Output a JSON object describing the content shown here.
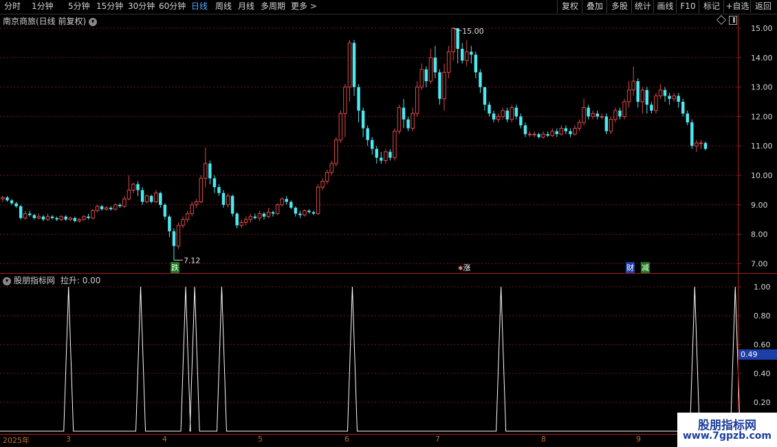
{
  "toolbar": {
    "periods": [
      "分时",
      "1分钟",
      "5分钟",
      "15分钟",
      "30分钟",
      "60分钟",
      "日线",
      "周线",
      "月线",
      "多周期",
      "更多 >"
    ],
    "active": "日线",
    "actions": [
      "复权",
      "叠加",
      "多股",
      "统计",
      "画线",
      "F10",
      "标记",
      "+自选",
      "返回"
    ]
  },
  "main": {
    "title": "南京商旅(日线 前复权)",
    "y_ticks": [
      "15.00",
      "14.00",
      "13.00",
      "12.00",
      "11.00",
      "10.00",
      "9.00",
      "8.00",
      "7.00"
    ],
    "high_label": "15.00",
    "low_label": "7.12",
    "markers": [
      "跌",
      "涨",
      "财",
      "减"
    ]
  },
  "indicator": {
    "name": "股朋指标网",
    "value_text": "拉升: 0.00",
    "y_ticks": [
      "1.00",
      "0.80",
      "0.60",
      "0.40",
      "0.20"
    ],
    "current_value": "0.49"
  },
  "xaxis": {
    "labels": [
      "2025年",
      "3",
      "4",
      "5",
      "6",
      "7",
      "8",
      "9"
    ]
  },
  "watermark": {
    "line1": "股朋指标网",
    "line2": "www.7gpzb.com"
  },
  "colors": {
    "up": "#e54a4a",
    "down": "#4de8f0",
    "grid": "#7a1c1c",
    "axis": "#b02020",
    "active_tab": "#5aa8ff",
    "indicator_line": "#ffffff",
    "value_box": "#1f3fa8"
  },
  "chart_data": [
    {
      "type": "candlestick",
      "title": "南京商旅(日线 前复权)",
      "ylim": [
        6.8,
        15.2
      ],
      "y_ticks": [
        15,
        14,
        13,
        12,
        11,
        10,
        9,
        8,
        7
      ],
      "annotations": [
        {
          "text": "15.00",
          "value": 15.0
        },
        {
          "text": "7.12",
          "value": 7.12
        }
      ],
      "candles": [
        [
          9.2,
          9.25,
          9.1,
          9.3
        ],
        [
          9.25,
          9.15,
          9.1,
          9.3
        ],
        [
          9.15,
          9.05,
          9.0,
          9.2
        ],
        [
          9.05,
          8.95,
          8.9,
          9.1
        ],
        [
          8.95,
          8.55,
          8.5,
          9.0
        ],
        [
          8.55,
          8.7,
          8.5,
          8.8
        ],
        [
          8.7,
          8.65,
          8.6,
          8.8
        ],
        [
          8.65,
          8.55,
          8.5,
          8.7
        ],
        [
          8.55,
          8.6,
          8.5,
          8.7
        ],
        [
          8.6,
          8.5,
          8.45,
          8.65
        ],
        [
          8.5,
          8.6,
          8.45,
          8.7
        ],
        [
          8.6,
          8.55,
          8.5,
          8.65
        ],
        [
          8.55,
          8.5,
          8.45,
          8.6
        ],
        [
          8.5,
          8.6,
          8.45,
          8.65
        ],
        [
          8.6,
          8.5,
          8.45,
          8.65
        ],
        [
          8.5,
          8.55,
          8.45,
          8.6
        ],
        [
          8.55,
          8.45,
          8.4,
          8.6
        ],
        [
          8.45,
          8.5,
          8.4,
          8.55
        ],
        [
          8.5,
          8.6,
          8.45,
          8.65
        ],
        [
          8.6,
          8.55,
          8.5,
          8.7
        ],
        [
          8.55,
          8.8,
          8.5,
          8.85
        ],
        [
          8.8,
          8.95,
          8.75,
          9.0
        ],
        [
          8.95,
          8.85,
          8.8,
          9.0
        ],
        [
          8.85,
          8.9,
          8.8,
          8.95
        ],
        [
          8.9,
          8.85,
          8.8,
          8.95
        ],
        [
          8.85,
          9.0,
          8.8,
          9.05
        ],
        [
          9.0,
          8.95,
          8.9,
          9.05
        ],
        [
          8.95,
          9.2,
          8.9,
          9.3
        ],
        [
          9.2,
          9.5,
          9.15,
          10.0
        ],
        [
          9.5,
          9.7,
          9.4,
          9.75
        ],
        [
          9.7,
          9.5,
          9.3,
          9.8
        ],
        [
          9.5,
          9.1,
          9.0,
          9.6
        ],
        [
          9.1,
          9.3,
          9.05,
          9.35
        ],
        [
          9.3,
          9.1,
          9.05,
          9.35
        ],
        [
          9.1,
          9.4,
          9.05,
          9.5
        ],
        [
          9.4,
          9.0,
          8.9,
          9.45
        ],
        [
          9.0,
          8.6,
          8.5,
          9.05
        ],
        [
          8.6,
          8.1,
          7.9,
          8.65
        ],
        [
          8.1,
          7.6,
          7.12,
          8.2
        ],
        [
          7.6,
          8.3,
          7.5,
          8.4
        ],
        [
          8.3,
          8.5,
          8.2,
          8.6
        ],
        [
          8.5,
          8.7,
          8.4,
          8.8
        ],
        [
          8.7,
          9.0,
          8.6,
          9.1
        ],
        [
          9.0,
          9.1,
          8.9,
          9.2
        ],
        [
          9.1,
          9.9,
          9.05,
          10.0
        ],
        [
          9.9,
          10.4,
          9.6,
          10.95
        ],
        [
          10.4,
          9.9,
          9.7,
          10.5
        ],
        [
          9.9,
          9.6,
          9.4,
          10.0
        ],
        [
          9.6,
          9.4,
          9.3,
          9.7
        ],
        [
          9.4,
          9.0,
          8.9,
          9.5
        ],
        [
          9.0,
          9.3,
          8.9,
          9.4
        ],
        [
          9.3,
          8.7,
          8.6,
          9.35
        ],
        [
          8.7,
          8.3,
          8.2,
          8.75
        ],
        [
          8.3,
          8.4,
          8.2,
          8.5
        ],
        [
          8.4,
          8.5,
          8.3,
          8.6
        ],
        [
          8.5,
          8.6,
          8.4,
          8.7
        ],
        [
          8.6,
          8.55,
          8.5,
          8.7
        ],
        [
          8.55,
          8.7,
          8.45,
          8.8
        ],
        [
          8.7,
          8.6,
          8.5,
          8.75
        ],
        [
          8.6,
          8.75,
          8.55,
          8.9
        ],
        [
          8.75,
          8.7,
          8.6,
          8.8
        ],
        [
          8.7,
          9.0,
          8.65,
          9.05
        ],
        [
          9.0,
          9.2,
          8.95,
          9.25
        ],
        [
          9.2,
          9.1,
          9.0,
          9.3
        ],
        [
          9.1,
          8.9,
          8.85,
          9.15
        ],
        [
          8.9,
          8.7,
          8.6,
          8.95
        ],
        [
          8.7,
          8.65,
          8.55,
          8.8
        ],
        [
          8.65,
          8.8,
          8.6,
          8.85
        ],
        [
          8.8,
          8.75,
          8.7,
          8.85
        ],
        [
          8.75,
          8.7,
          8.65,
          8.8
        ],
        [
          8.7,
          9.6,
          8.65,
          9.7
        ],
        [
          9.6,
          9.8,
          9.5,
          9.9
        ],
        [
          9.8,
          10.1,
          9.7,
          10.2
        ],
        [
          10.1,
          10.4,
          10.0,
          10.5
        ],
        [
          10.4,
          11.2,
          10.3,
          11.3
        ],
        [
          11.2,
          12.1,
          11.1,
          12.2
        ],
        [
          12.1,
          13.0,
          11.3,
          13.1
        ],
        [
          13.0,
          14.5,
          12.5,
          14.6
        ],
        [
          14.5,
          13.0,
          12.7,
          14.6
        ],
        [
          13.0,
          12.2,
          11.8,
          13.1
        ],
        [
          12.2,
          11.6,
          11.3,
          12.3
        ],
        [
          11.6,
          11.2,
          11.0,
          11.7
        ],
        [
          11.2,
          10.9,
          10.7,
          11.3
        ],
        [
          10.9,
          10.6,
          10.4,
          11.0
        ],
        [
          10.6,
          10.5,
          10.4,
          10.8
        ],
        [
          10.5,
          10.8,
          10.4,
          10.9
        ],
        [
          10.8,
          10.6,
          10.5,
          10.9
        ],
        [
          10.6,
          11.5,
          10.5,
          11.6
        ],
        [
          11.5,
          12.3,
          11.4,
          12.4
        ],
        [
          12.3,
          11.9,
          11.6,
          12.6
        ],
        [
          11.9,
          11.6,
          11.5,
          12.0
        ],
        [
          11.6,
          12.1,
          11.5,
          12.3
        ],
        [
          12.1,
          13.0,
          12.0,
          13.2
        ],
        [
          13.0,
          13.6,
          12.9,
          13.8
        ],
        [
          13.6,
          13.2,
          13.0,
          13.7
        ],
        [
          13.2,
          14.0,
          13.1,
          14.3
        ],
        [
          14.0,
          13.5,
          13.3,
          14.4
        ],
        [
          13.5,
          12.6,
          12.4,
          13.6
        ],
        [
          12.6,
          13.5,
          12.2,
          13.8
        ],
        [
          13.5,
          14.2,
          13.3,
          14.4
        ],
        [
          14.2,
          15.0,
          13.9,
          15.0
        ],
        [
          15.0,
          14.3,
          13.8,
          15.0
        ],
        [
          14.3,
          13.9,
          13.8,
          14.5
        ],
        [
          13.9,
          14.2,
          13.7,
          14.6
        ],
        [
          14.2,
          14.1,
          13.8,
          14.4
        ],
        [
          14.1,
          13.5,
          13.3,
          14.2
        ],
        [
          13.5,
          13.0,
          12.8,
          13.6
        ],
        [
          13.0,
          12.4,
          12.2,
          13.0
        ],
        [
          12.4,
          12.1,
          12.0,
          12.5
        ],
        [
          12.1,
          11.9,
          11.8,
          12.2
        ],
        [
          11.9,
          12.0,
          11.8,
          12.1
        ],
        [
          12.0,
          12.2,
          11.9,
          12.3
        ],
        [
          12.2,
          11.9,
          11.8,
          12.3
        ],
        [
          11.9,
          12.3,
          11.8,
          12.4
        ],
        [
          12.3,
          12.0,
          11.9,
          12.4
        ],
        [
          12.0,
          11.7,
          11.6,
          12.1
        ],
        [
          11.7,
          11.4,
          11.3,
          11.8
        ],
        [
          11.4,
          11.4,
          11.3,
          11.5
        ],
        [
          11.4,
          11.4,
          11.3,
          11.5
        ],
        [
          11.4,
          11.3,
          11.25,
          11.45
        ],
        [
          11.3,
          11.4,
          11.25,
          11.5
        ],
        [
          11.4,
          11.35,
          11.3,
          11.5
        ],
        [
          11.35,
          11.5,
          11.3,
          11.6
        ],
        [
          11.5,
          11.4,
          11.3,
          11.6
        ],
        [
          11.4,
          11.6,
          11.35,
          11.7
        ],
        [
          11.6,
          11.5,
          11.4,
          11.7
        ],
        [
          11.5,
          11.4,
          11.3,
          11.6
        ],
        [
          11.4,
          11.6,
          11.35,
          11.7
        ],
        [
          11.6,
          11.8,
          11.5,
          11.9
        ],
        [
          11.8,
          12.3,
          11.7,
          12.6
        ],
        [
          12.3,
          12.0,
          11.9,
          12.4
        ],
        [
          12.0,
          12.1,
          11.9,
          12.2
        ],
        [
          12.1,
          12.0,
          11.9,
          12.2
        ],
        [
          12.0,
          12.0,
          11.9,
          12.1
        ],
        [
          12.0,
          11.5,
          11.4,
          12.1
        ],
        [
          11.5,
          11.9,
          11.4,
          12.0
        ],
        [
          11.9,
          12.2,
          11.8,
          12.3
        ],
        [
          12.2,
          12.0,
          11.9,
          12.3
        ],
        [
          12.0,
          12.5,
          11.9,
          12.6
        ],
        [
          12.5,
          12.9,
          12.3,
          13.2
        ],
        [
          12.9,
          13.2,
          12.7,
          13.7
        ],
        [
          13.2,
          12.5,
          12.3,
          13.3
        ],
        [
          12.5,
          12.9,
          12.1,
          13.0
        ],
        [
          12.9,
          12.4,
          12.1,
          13.0
        ],
        [
          12.4,
          12.2,
          12.1,
          12.5
        ],
        [
          12.2,
          12.7,
          12.1,
          12.8
        ],
        [
          12.7,
          12.9,
          12.6,
          13.1
        ],
        [
          12.9,
          12.7,
          12.5,
          13.0
        ],
        [
          12.7,
          12.6,
          12.4,
          12.8
        ],
        [
          12.6,
          12.7,
          12.5,
          12.8
        ],
        [
          12.7,
          12.5,
          12.3,
          12.8
        ],
        [
          12.5,
          12.1,
          12.0,
          12.6
        ],
        [
          12.1,
          11.8,
          11.7,
          12.2
        ],
        [
          11.8,
          11.0,
          10.9,
          11.9
        ],
        [
          11.0,
          11.1,
          10.8,
          11.2
        ],
        [
          11.1,
          11.1,
          10.9,
          11.2
        ],
        [
          11.1,
          10.9,
          10.85,
          11.15
        ]
      ]
    },
    {
      "type": "line",
      "title": "股朋指标网",
      "ylim": [
        0.05,
        1.05
      ],
      "y_ticks": [
        1.0,
        0.8,
        0.6,
        0.4,
        0.2
      ],
      "series": [
        {
          "name": "拉升",
          "spike_indices": [
            14,
            30,
            40,
            42,
            48,
            77,
            110,
            153,
            162
          ],
          "base": 0.0,
          "peak": 1.0
        }
      ]
    }
  ]
}
